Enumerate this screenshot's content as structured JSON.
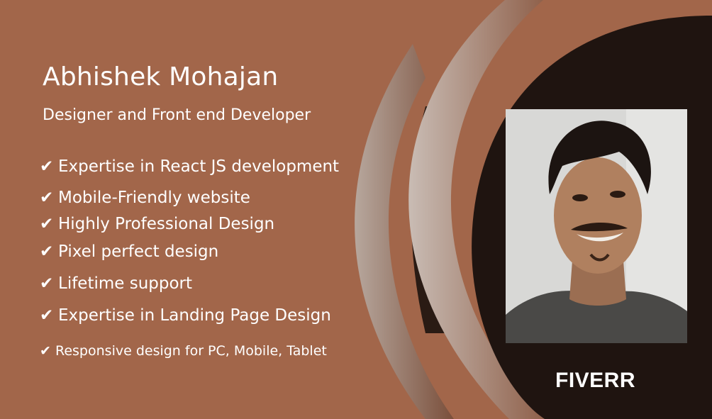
{
  "profile": {
    "name": "Abhishek Mohajan",
    "title": "Designer and Front end Developer"
  },
  "features": [
    {
      "check": "✔",
      "text": "Expertise in React JS development"
    },
    {
      "check": "✔",
      "text": "Mobile-Friendly website"
    },
    {
      "check": "✔",
      "text": "Highly Professional Design"
    },
    {
      "check": "✔",
      "text": "Pixel perfect design"
    },
    {
      "check": "✔",
      "text": "Lifetime support"
    },
    {
      "check": "✔",
      "text": "Expertise in Landing Page Design"
    },
    {
      "check": "✔",
      "text": "Responsive design for PC, Mobile, Tablet"
    }
  ],
  "brand": "FIVERR",
  "colors": {
    "background": "#a2664a",
    "dark_panel": "#1f1410",
    "arc_light": "#b9aaa1",
    "text": "#ffffff"
  },
  "photo": {
    "icon": "person-portrait"
  }
}
